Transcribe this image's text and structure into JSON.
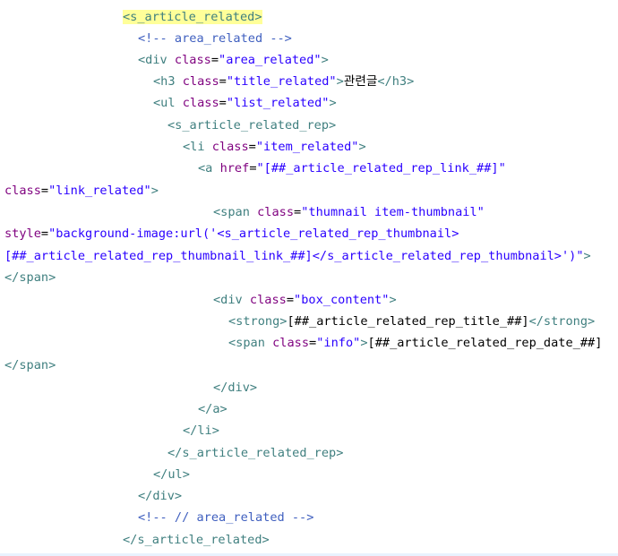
{
  "editor": {
    "lines": [
      {
        "tokens": [
          {
            "k": "t",
            "text": "<s_article_related>",
            "hl": true
          }
        ]
      },
      {
        "tokens": [
          {
            "k": "c",
            "text": "<!-- area_related -->"
          }
        ]
      },
      {
        "tokens": [
          {
            "k": "t",
            "text": "<div "
          },
          {
            "k": "a",
            "text": "class"
          },
          {
            "k": "p",
            "text": "="
          },
          {
            "k": "v",
            "text": "\"area_related\""
          },
          {
            "k": "t",
            "text": ">"
          }
        ]
      },
      {
        "tokens": [
          {
            "k": "t",
            "text": "<h3 "
          },
          {
            "k": "a",
            "text": "class"
          },
          {
            "k": "p",
            "text": "="
          },
          {
            "k": "v",
            "text": "\"title_related\""
          },
          {
            "k": "t",
            "text": ">"
          },
          {
            "k": "p",
            "text": "관련글"
          },
          {
            "k": "t",
            "text": "</h3>"
          }
        ]
      },
      {
        "tokens": [
          {
            "k": "t",
            "text": "<ul "
          },
          {
            "k": "a",
            "text": "class"
          },
          {
            "k": "p",
            "text": "="
          },
          {
            "k": "v",
            "text": "\"list_related\""
          },
          {
            "k": "t",
            "text": ">"
          }
        ]
      },
      {
        "tokens": [
          {
            "k": "t",
            "text": "<s_article_related_rep>"
          }
        ]
      },
      {
        "tokens": [
          {
            "k": "t",
            "text": "<li "
          },
          {
            "k": "a",
            "text": "class"
          },
          {
            "k": "p",
            "text": "="
          },
          {
            "k": "v",
            "text": "\"item_related\""
          },
          {
            "k": "t",
            "text": ">"
          }
        ]
      },
      {
        "tokens": [
          {
            "k": "t",
            "text": "<a "
          },
          {
            "k": "a",
            "text": "href"
          },
          {
            "k": "p",
            "text": "="
          },
          {
            "k": "v",
            "text": "\"[##_article_related_rep_link_##]\""
          }
        ]
      },
      {
        "tokens": [
          {
            "k": "a",
            "text": "class"
          },
          {
            "k": "p",
            "text": "="
          },
          {
            "k": "v",
            "text": "\"link_related\""
          },
          {
            "k": "t",
            "text": ">"
          }
        ]
      },
      {
        "tokens": [
          {
            "k": "t",
            "text": "<span "
          },
          {
            "k": "a",
            "text": "class"
          },
          {
            "k": "p",
            "text": "="
          },
          {
            "k": "v",
            "text": "\"thumnail item-thumbnail\""
          }
        ]
      },
      {
        "tokens": [
          {
            "k": "a",
            "text": "style"
          },
          {
            "k": "p",
            "text": "="
          },
          {
            "k": "v",
            "text": "\"background-image:url('<s_article_related_rep_thumbnail>"
          }
        ]
      },
      {
        "tokens": [
          {
            "k": "v",
            "text": "[##_article_related_rep_thumbnail_link_##]</s_article_related_rep_thumbnail>')\""
          },
          {
            "k": "t",
            "text": ">"
          }
        ]
      },
      {
        "tokens": [
          {
            "k": "t",
            "text": "</span>"
          }
        ]
      },
      {
        "tokens": [
          {
            "k": "t",
            "text": "<div "
          },
          {
            "k": "a",
            "text": "class"
          },
          {
            "k": "p",
            "text": "="
          },
          {
            "k": "v",
            "text": "\"box_content\""
          },
          {
            "k": "t",
            "text": ">"
          }
        ]
      },
      {
        "tokens": [
          {
            "k": "t",
            "text": "<strong>"
          },
          {
            "k": "p",
            "text": "[##_article_related_rep_title_##]"
          },
          {
            "k": "t",
            "text": "</strong>"
          }
        ]
      },
      {
        "tokens": [
          {
            "k": "t",
            "text": "<span "
          },
          {
            "k": "a",
            "text": "class"
          },
          {
            "k": "p",
            "text": "="
          },
          {
            "k": "v",
            "text": "\"info\""
          },
          {
            "k": "t",
            "text": ">"
          },
          {
            "k": "p",
            "text": "[##_article_related_rep_date_##]"
          }
        ]
      },
      {
        "tokens": [
          {
            "k": "t",
            "text": "</span>"
          }
        ]
      },
      {
        "tokens": [
          {
            "k": "t",
            "text": "</div>"
          }
        ]
      },
      {
        "tokens": [
          {
            "k": "t",
            "text": "</a>"
          }
        ]
      },
      {
        "tokens": [
          {
            "k": "t",
            "text": "</li>"
          }
        ]
      },
      {
        "tokens": [
          {
            "k": "t",
            "text": "</s_article_related_rep>"
          }
        ]
      },
      {
        "tokens": [
          {
            "k": "t",
            "text": "</ul>"
          }
        ]
      },
      {
        "tokens": [
          {
            "k": "t",
            "text": "</div>"
          }
        ]
      },
      {
        "tokens": [
          {
            "k": "c",
            "text": "<!-- // area_related -->"
          }
        ]
      },
      {
        "tokens": [
          {
            "k": "t",
            "text": "</s_article_related>"
          }
        ]
      }
    ]
  },
  "colors": {
    "tag": "#3f7f7f",
    "attribute": "#7f007f",
    "value": "#2a00ff",
    "comment": "#3f5fbf",
    "highlight": "#ffff99"
  }
}
